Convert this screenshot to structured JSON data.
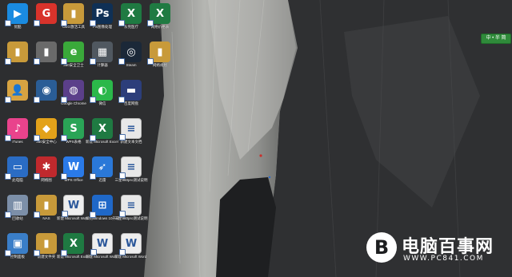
{
  "desktop": {
    "icons": [
      {
        "label": "优酷",
        "glyph": "▶",
        "color": "#1a8be0"
      },
      {
        "label": "",
        "glyph": "G",
        "color": "#d8332b"
      },
      {
        "label": "OEO激活工具",
        "glyph": "▮",
        "color": "#c89a3a"
      },
      {
        "label": "PS图像处理",
        "glyph": "Ps",
        "color": "#0f3055"
      },
      {
        "label": "东莞医疗",
        "glyph": "X",
        "color": "#1f7a42"
      },
      {
        "label": "网络价格表",
        "glyph": "X",
        "color": "#1f7a42"
      },
      {
        "label": "",
        "glyph": "▮",
        "color": "#c89a3a"
      },
      {
        "label": "",
        "glyph": "▮",
        "color": "#6a6a6a"
      },
      {
        "label": "360安全卫士",
        "glyph": "e",
        "color": "#3aa93a"
      },
      {
        "label": "计算器",
        "glyph": "▦",
        "color": "#505860"
      },
      {
        "label": "Steam",
        "glyph": "◎",
        "color": "#1b2838"
      },
      {
        "label": "网络规划",
        "glyph": "▮",
        "color": "#c89a3a"
      },
      {
        "label": "",
        "glyph": "👤",
        "color": "#d7a341"
      },
      {
        "label": "",
        "glyph": "◉",
        "color": "#2a5d96"
      },
      {
        "label": "Google Chrome",
        "glyph": "◍",
        "color": "#5b3f8a"
      },
      {
        "label": "微信",
        "glyph": "◐",
        "color": "#2bb84a"
      },
      {
        "label": "百度网盘",
        "glyph": "▬",
        "color": "#2c3e7a"
      },
      {
        "label": "iTunes",
        "glyph": "♪",
        "color": "#e9438c"
      },
      {
        "label": "360安全中心",
        "glyph": "◆",
        "color": "#e3a21a"
      },
      {
        "label": "WPS表格",
        "glyph": "S",
        "color": "#2aa456"
      },
      {
        "label": "新建 Microsoft Excel 工作表",
        "glyph": "X",
        "color": "#1f7a42"
      },
      {
        "label": "新建文本文档",
        "glyph": "≡",
        "color": "#e8e8e8"
      },
      {
        "label": "此电脑",
        "glyph": "▭",
        "color": "#2a6cc4"
      },
      {
        "label": "网络图",
        "glyph": "✱",
        "color": "#c0292d"
      },
      {
        "label": "WPS Office",
        "glyph": "W",
        "color": "#2a7ae8"
      },
      {
        "label": "迅雷",
        "glyph": "➶",
        "color": "#2a78d8"
      },
      {
        "label": "三星960pro测试说明",
        "glyph": "≡",
        "color": "#e8e8e8"
      },
      {
        "label": "回收站",
        "glyph": "▥",
        "color": "#7c8fa8"
      },
      {
        "label": "NAS",
        "glyph": "▮",
        "color": "#c89a3a"
      },
      {
        "label": "新建 Microsoft Word 文档",
        "glyph": "W",
        "color": "#eeeeee"
      },
      {
        "label": "如何Windows 10升级",
        "glyph": "⊞",
        "color": "#1f68c8"
      },
      {
        "label": "三星960pro测试说明",
        "glyph": "≡",
        "color": "#e8e8e8"
      },
      {
        "label": "控制面板",
        "glyph": "▣",
        "color": "#3a7ec8"
      },
      {
        "label": "新建文件夹",
        "glyph": "▮",
        "color": "#c89a3a"
      },
      {
        "label": "新建 Microsoft Excel 工作表",
        "glyph": "X",
        "color": "#1f7a42"
      },
      {
        "label": "新建 Microsoft Word 97-20...",
        "glyph": "W",
        "color": "#eeeeee"
      },
      {
        "label": "新建 Microsoft Word 文档",
        "glyph": "W",
        "color": "#eeeeee"
      }
    ]
  },
  "ime": {
    "label": "中 • 半 简"
  },
  "watermark": {
    "logo_glyph": "B",
    "title": "电脑百事网",
    "url": "WWW.PC841.COM"
  },
  "colors": {
    "rock_dark": "#2b2c2e",
    "rock_light": "#9a9b98",
    "sky_crack": "#3c3d3f"
  }
}
